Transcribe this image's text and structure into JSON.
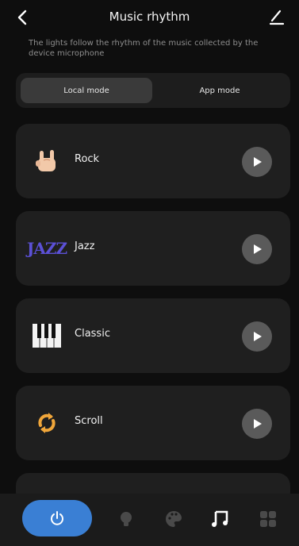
{
  "header": {
    "title": "Music rhythm",
    "description": "The lights follow the rhythm of the music collected by the device microphone"
  },
  "mode_tabs": {
    "local": "Local mode",
    "app": "App mode"
  },
  "modes": [
    {
      "label": "Rock",
      "icon": "rock-hand-icon"
    },
    {
      "label": "Jazz",
      "icon": "jazz-logo-icon",
      "icon_text": "JAZZ"
    },
    {
      "label": "Classic",
      "icon": "piano-keys-icon"
    },
    {
      "label": "Scroll",
      "icon": "scroll-arrows-icon"
    }
  ],
  "tabbar": {
    "items": [
      "power-icon",
      "bulb-icon",
      "palette-icon",
      "music-icon",
      "grid-icon"
    ],
    "active": "music-icon"
  },
  "colors": {
    "accent": "#3a7fd4",
    "card": "#1f1f1f",
    "background": "#0e0e0e",
    "jazz": "#5b50d6",
    "scroll": "#f0a63a"
  }
}
